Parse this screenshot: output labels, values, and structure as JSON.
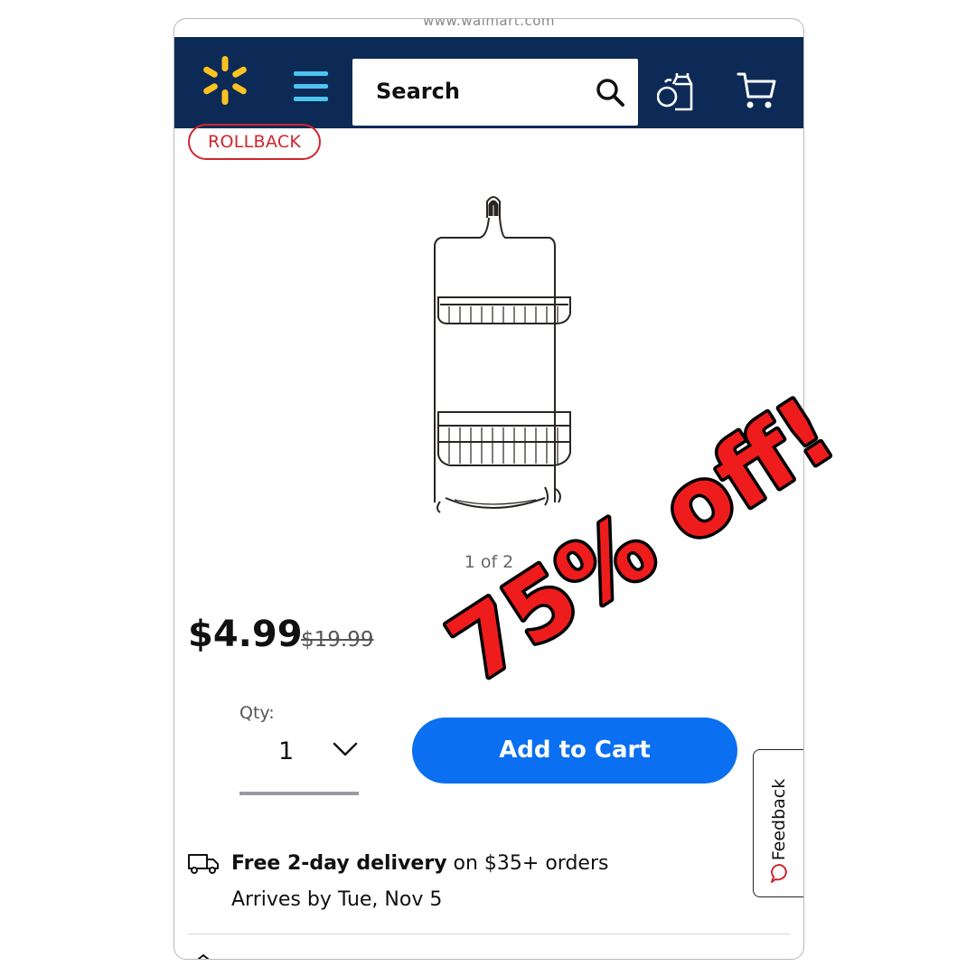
{
  "browser": {
    "url": "www.walmart.com"
  },
  "header": {
    "search_placeholder": "Search",
    "colors": {
      "bar": "#0c2a55",
      "spark": "#ffc220",
      "menu": "#4dc4f2"
    }
  },
  "product": {
    "badge": "ROLLBACK",
    "image_pager": "1 of 2",
    "price_current": "$4.99",
    "price_was": "$19.99"
  },
  "purchase": {
    "qty_label": "Qty:",
    "qty_value": "1",
    "add_to_cart": "Add to Cart",
    "button_color": "#0a6ff0"
  },
  "delivery": {
    "headline": "Free 2-day delivery",
    "condition": " on $35+ orders",
    "arrives": "Arrives by Tue, Nov 5"
  },
  "feedback": {
    "label": "Feedback"
  },
  "overlay": {
    "promo_text": "75% off!",
    "color": "#ee1c1c"
  }
}
